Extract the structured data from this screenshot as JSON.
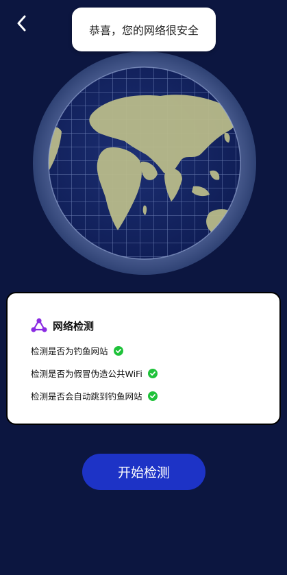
{
  "toast": {
    "message": "恭喜，您的网络很安全"
  },
  "icons": {
    "back": "chevron-left-icon",
    "network": "network-nodes-icon",
    "check": "check-circle-icon",
    "globe": "globe-illustration"
  },
  "card": {
    "title": "网络检测",
    "checks": [
      {
        "label": "检测是否为钓鱼网站",
        "status": "passed"
      },
      {
        "label": "检测是否为假冒伪造公共WiFi",
        "status": "passed"
      },
      {
        "label": "检测是否会自动跳到钓鱼网站",
        "status": "passed"
      }
    ]
  },
  "actions": {
    "start_label": "开始检测"
  },
  "colors": {
    "background": "#0c1640",
    "accent": "#1d33c6",
    "success": "#1fc23a",
    "icon_purple": "#8a2be2"
  }
}
